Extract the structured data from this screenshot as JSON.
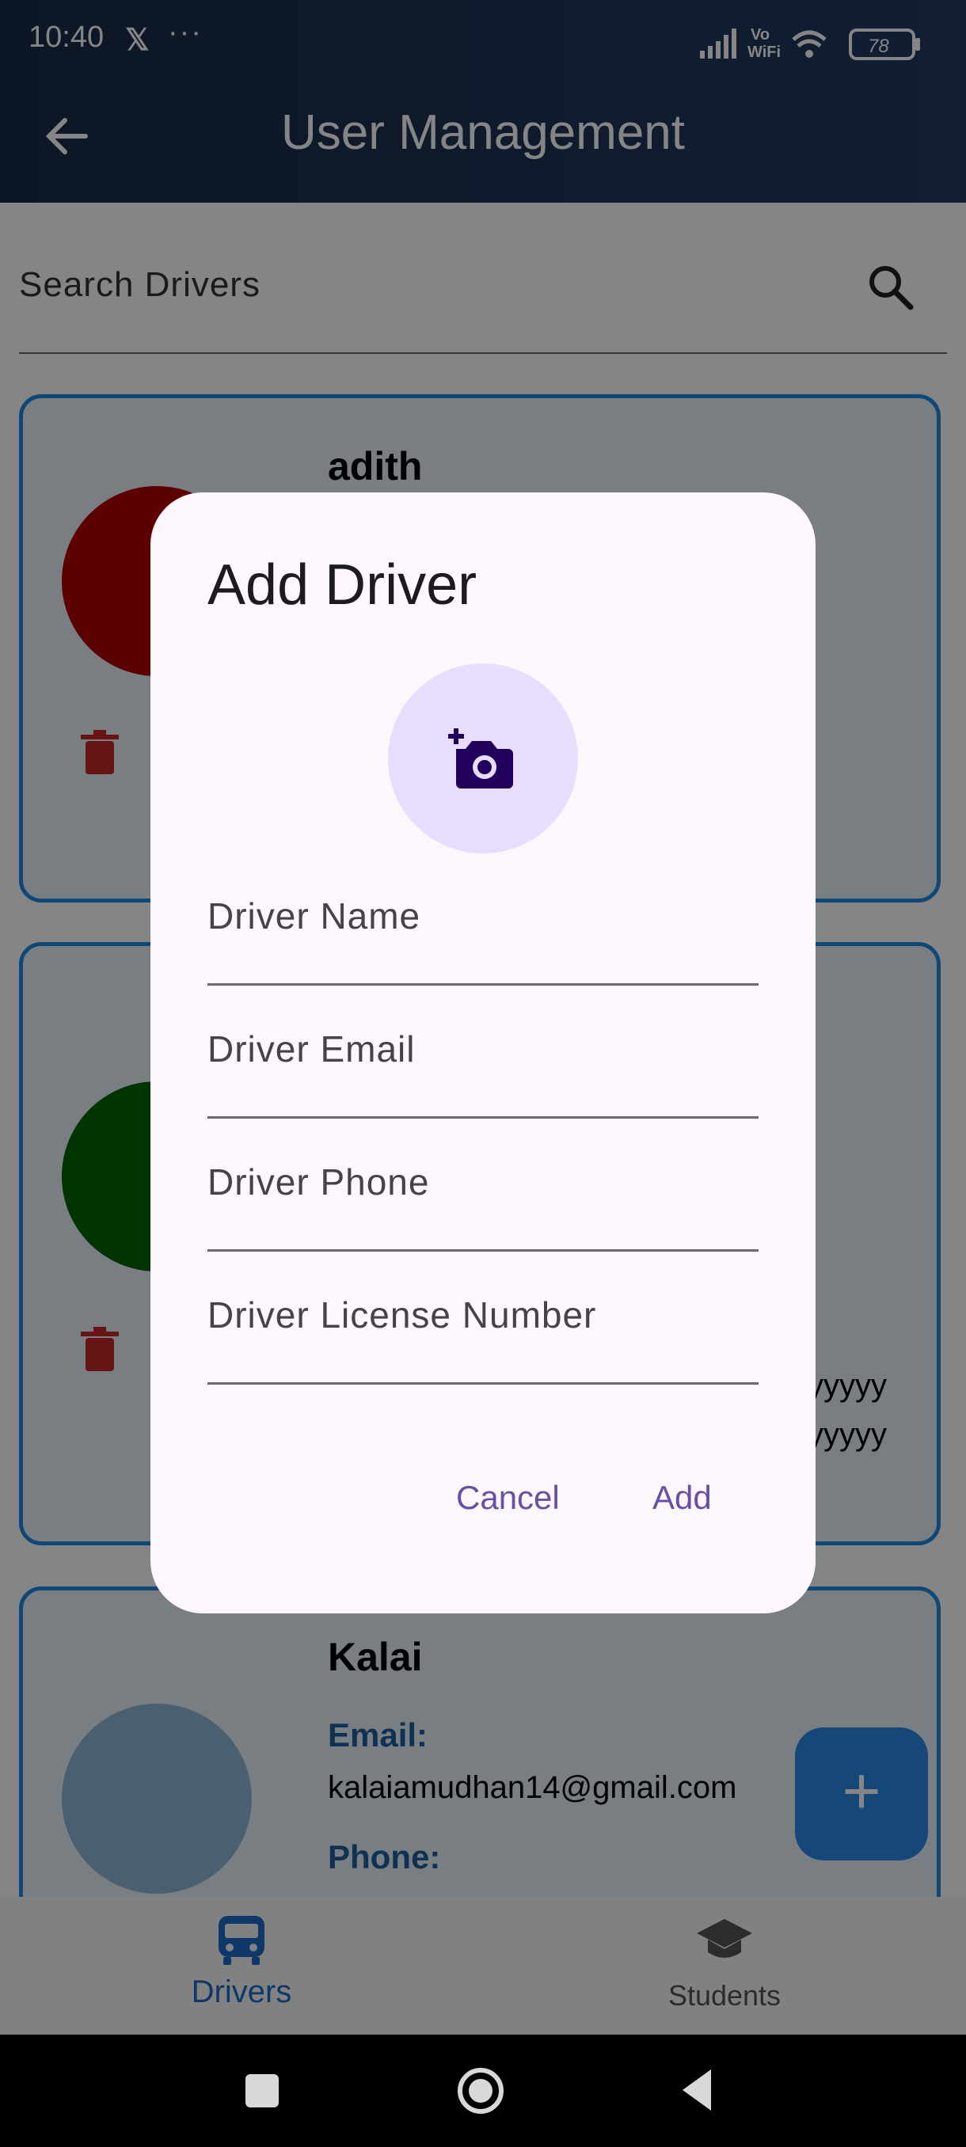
{
  "status_bar": {
    "time": "10:40",
    "x_icon": "𝕏",
    "dots": "···",
    "battery": "78",
    "vo_wifi_top": "Vo",
    "vo_wifi_bottom": "WiFi"
  },
  "app_bar": {
    "title": "User Management",
    "back_icon": "arrow-left-icon"
  },
  "search": {
    "placeholder": "Search Drivers",
    "icon": "search-icon"
  },
  "cards": [
    {
      "name": "adith",
      "avatar_color": "#b00000"
    },
    {
      "name": "",
      "avatar_color": "#006400",
      "partial_text_1": "yyyyy",
      "partial_text_2": "yyyyy"
    },
    {
      "name": "Kalai",
      "avatar_color": "#8fb7d6",
      "email_label": "Email:",
      "email": "kalaiamudhan14@gmail.com",
      "phone_label": "Phone:"
    }
  ],
  "fab": {
    "label": "+"
  },
  "bottom_nav": {
    "items": [
      {
        "label": "Drivers",
        "icon": "bus-icon",
        "active": true
      },
      {
        "label": "Students",
        "icon": "graduation-cap-icon",
        "active": false
      }
    ]
  },
  "dialog": {
    "title": "Add Driver",
    "photo_icon": "add-a-photo-icon",
    "fields": [
      {
        "placeholder": "Driver Name",
        "value": ""
      },
      {
        "placeholder": "Driver Email",
        "value": ""
      },
      {
        "placeholder": "Driver Phone",
        "value": ""
      },
      {
        "placeholder": "Driver License Number",
        "value": ""
      }
    ],
    "cancel_label": "Cancel",
    "add_label": "Add"
  },
  "colors": {
    "accent": "#1e88e5",
    "dialog_bg": "#fdf6fc",
    "dialog_button": "#6750a4",
    "photo_circle": "#e8ddff"
  }
}
